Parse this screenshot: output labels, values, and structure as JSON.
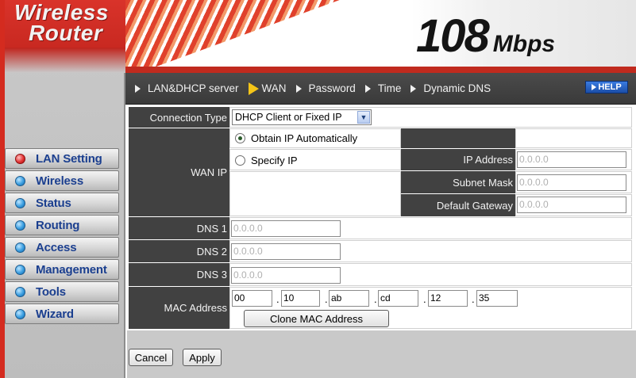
{
  "brand": {
    "line1": "Wireless",
    "line2": "Router",
    "speed_num": "108",
    "speed_unit": "Mbps"
  },
  "sidebar": {
    "items": [
      {
        "label": "LAN Setting",
        "active": true
      },
      {
        "label": "Wireless",
        "active": false
      },
      {
        "label": "Status",
        "active": false
      },
      {
        "label": "Routing",
        "active": false
      },
      {
        "label": "Access",
        "active": false
      },
      {
        "label": "Management",
        "active": false
      },
      {
        "label": "Tools",
        "active": false
      },
      {
        "label": "Wizard",
        "active": false
      }
    ]
  },
  "topnav": {
    "items": [
      {
        "label": "LAN&DHCP server",
        "active": false
      },
      {
        "label": "WAN",
        "active": true
      },
      {
        "label": "Password",
        "active": false
      },
      {
        "label": "Time",
        "active": false
      },
      {
        "label": "Dynamic DNS",
        "active": false
      }
    ],
    "help_label": "HELP"
  },
  "form": {
    "connection_type_label": "Connection Type",
    "connection_type_value": "DHCP Client or Fixed IP",
    "wan_ip_label": "WAN IP",
    "radio_obtain": "Obtain IP Automatically",
    "radio_specify": "Specify IP",
    "ip_address_label": "IP Address",
    "ip_address_value": "0.0.0.0",
    "subnet_mask_label": "Subnet Mask",
    "subnet_mask_value": "0.0.0.0",
    "default_gateway_label": "Default Gateway",
    "default_gateway_value": "0.0.0.0",
    "dns1_label": "DNS 1",
    "dns1_value": "0.0.0.0",
    "dns2_label": "DNS 2",
    "dns2_value": "0.0.0.0",
    "dns3_label": "DNS 3",
    "dns3_value": "0.0.0.0",
    "mac_label": "MAC Address",
    "mac_parts": [
      "00",
      "10",
      "ab",
      "cd",
      "12",
      "35"
    ],
    "mac_sep": ".",
    "clone_mac_label": "Clone MAC Address"
  },
  "actions": {
    "cancel_label": "Cancel",
    "apply_label": "Apply"
  }
}
